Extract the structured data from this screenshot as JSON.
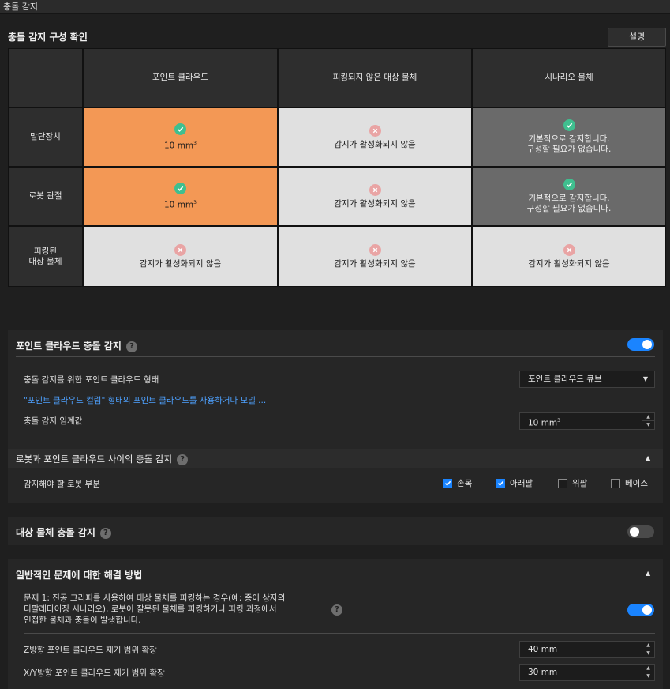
{
  "window": {
    "title": "충돌 감지"
  },
  "config": {
    "title": "충돌 감지 구성 확인",
    "help_label": "설명"
  },
  "matrix": {
    "columns": [
      "포인트 클라우드",
      "피킹되지 않은 대상 물체",
      "시나리오 물체"
    ],
    "rows": [
      {
        "label": "말단장치",
        "cells": [
          {
            "state": "on",
            "text": "10 mm",
            "unit_sup": "3"
          },
          {
            "state": "off",
            "text": "감지가 활성화되지 않음"
          },
          {
            "state": "default",
            "text1": "기본적으로 감지합니다.",
            "text2": "구성할 필요가 없습니다."
          }
        ]
      },
      {
        "label": "로봇 관절",
        "cells": [
          {
            "state": "on",
            "text": "10 mm",
            "unit_sup": "3"
          },
          {
            "state": "off",
            "text": "감지가 활성화되지 않음"
          },
          {
            "state": "default",
            "text1": "기본적으로 감지합니다.",
            "text2": "구성할 필요가 없습니다."
          }
        ]
      },
      {
        "label1": "피킹된",
        "label2": "대상 물체",
        "cells": [
          {
            "state": "off",
            "text": "감지가 활성화되지 않음"
          },
          {
            "state": "off",
            "text": "감지가 활성화되지 않음"
          },
          {
            "state": "off",
            "text": "감지가 활성화되지 않음"
          }
        ]
      }
    ],
    "colors": {
      "on": "#f39855",
      "off": "#e0e0e0",
      "default": "#6a6a6a",
      "check": "#3fbf8f",
      "cross": "#e9a4a4"
    }
  },
  "pointcloud": {
    "title": "포인트 클라우드 충돌 감지",
    "help_icon": "question-icon",
    "enabled": true,
    "form_label": "충돌 감지를 위한 포인트 클라우드 형태",
    "form_value": "포인트 클라우드 큐브",
    "link_text": "\"포인트 클라우드 컬럼\" 형태의 포인트 클라우드를 사용하거나 모델 ...",
    "threshold_label": "충돌 감지 임계값",
    "threshold_value": "10 mm",
    "threshold_sup": "3",
    "robot_sub": {
      "title": "로봇과 포인트 클라우드 사이의 충돌 감지",
      "parts_label": "감지해야 할 로봇 부분",
      "parts": [
        {
          "label": "손목",
          "checked": true
        },
        {
          "label": "아래팔",
          "checked": true
        },
        {
          "label": "위팔",
          "checked": false
        },
        {
          "label": "베이스",
          "checked": false
        }
      ]
    }
  },
  "target": {
    "title": "대상 물체 충돌 감지",
    "enabled": false
  },
  "faq": {
    "title": "일반적인 문제에 대한 해결 방법",
    "q1_line1": "문제 1: 진공 그리퍼를 사용하여 대상 물체를 피킹하는 경우(예: 종이 상자의",
    "q1_line2": "디팔레타이징 시나리오), 로봇이 잘못된 물체를 피킹하거나 피킹 과정에서",
    "q1_line3": "인접한 물체과 충돌이 발생합니다.",
    "q1_enabled": true,
    "z_label": "Z방향 포인트 클라우드 제거 범위 확장",
    "z_value": "40 mm",
    "xy_label": "X/Y방향 포인트 클라우드 제거 범위 확장",
    "xy_value": "30 mm"
  }
}
